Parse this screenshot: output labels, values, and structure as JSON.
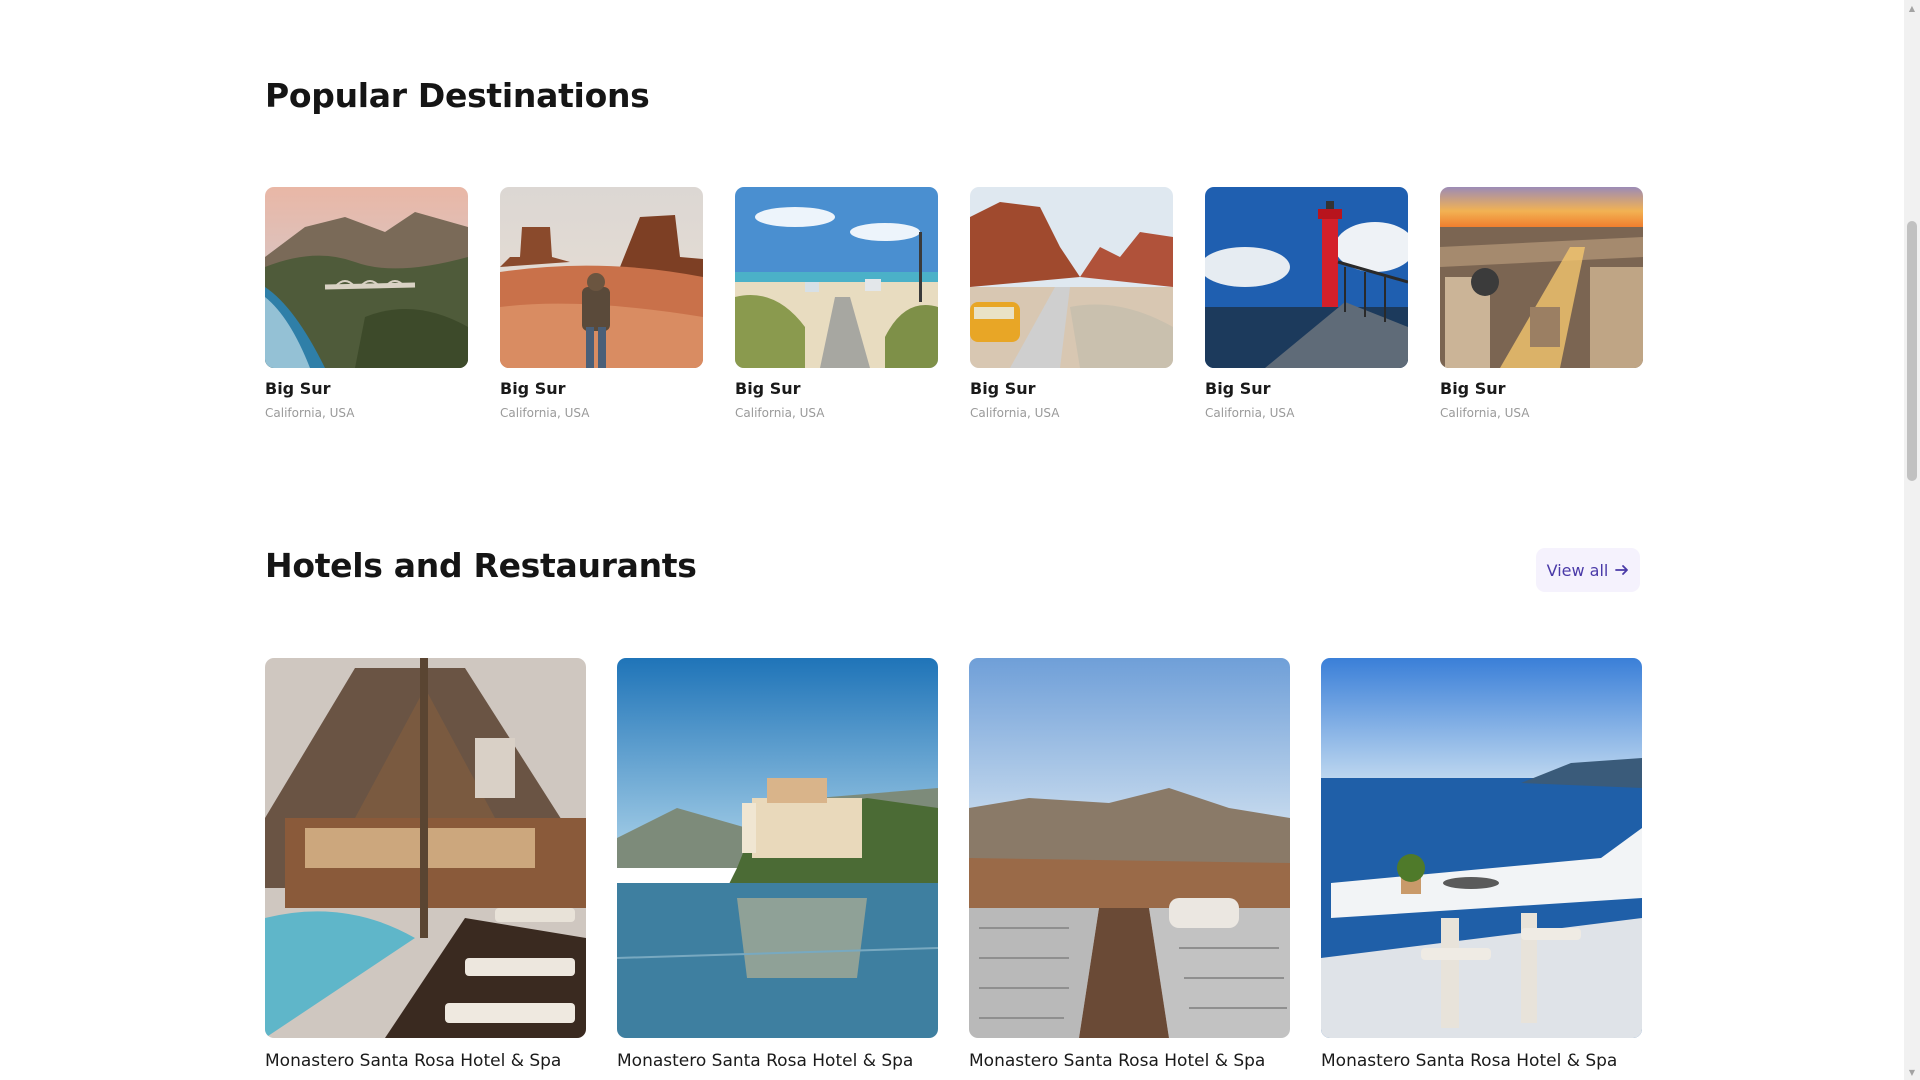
{
  "popular": {
    "title": "Popular Destinations",
    "items": [
      {
        "name": "Big Sur",
        "location": "California, USA"
      },
      {
        "name": "Big Sur",
        "location": "California, USA"
      },
      {
        "name": "Big Sur",
        "location": "California, USA"
      },
      {
        "name": "Big Sur",
        "location": "California, USA"
      },
      {
        "name": "Big Sur",
        "location": "California, USA"
      },
      {
        "name": "Big Sur",
        "location": "California, USA"
      }
    ]
  },
  "hotels": {
    "title": "Hotels and Restaurants",
    "view_all_label": "View all",
    "view_all_icon": "arrow-right-icon",
    "items": [
      {
        "name": "Monastero Santa Rosa Hotel & Spa"
      },
      {
        "name": "Monastero Santa Rosa Hotel & Spa"
      },
      {
        "name": "Monastero Santa Rosa Hotel & Spa"
      },
      {
        "name": "Monastero Santa Rosa Hotel & Spa"
      }
    ]
  },
  "colors": {
    "heading": "#151515",
    "muted_text": "#9a9a9a",
    "accent": "#4a3aa8",
    "accent_bg": "#f5f2fd"
  }
}
